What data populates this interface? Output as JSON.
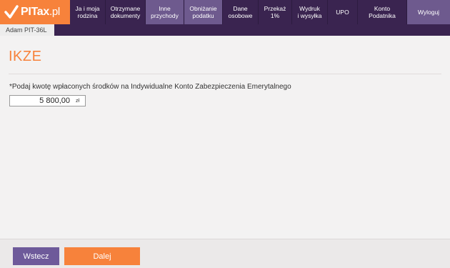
{
  "app": {
    "brand": "PITax",
    "brand_suffix": ".pl"
  },
  "nav": {
    "items": [
      {
        "key": "ja",
        "label": "Ja i moja\nrodzina"
      },
      {
        "key": "dokumenty",
        "label": "Otrzymane\ndokumenty"
      },
      {
        "key": "przychody",
        "label": "Inne\nprzychody"
      },
      {
        "key": "obnizanie",
        "label": "Obniżanie\npodatku"
      },
      {
        "key": "dane",
        "label": "Dane\nosobowe"
      },
      {
        "key": "przekaz",
        "label": "Przekaż\n1%"
      },
      {
        "key": "wydruk",
        "label": "Wydruk\ni wysyłka"
      },
      {
        "key": "upo",
        "label": "UPO"
      },
      {
        "key": "konto",
        "label": "Konto\nPodatnika"
      },
      {
        "key": "wyloguj",
        "label": "Wyloguj"
      }
    ]
  },
  "person_tab": "Adam PIT-36L",
  "page": {
    "title": "IKZE",
    "question": "*Podaj kwotę wpłaconych środków na Indywidualne Konto Zabezpieczenia Emerytalnego",
    "amount_value": "5 800,00",
    "currency": "zł"
  },
  "footer": {
    "back_label": "Wstecz",
    "next_label": "Dalej"
  },
  "colors": {
    "accent": "#f7823b",
    "nav_dark": "#3a2450",
    "nav_light": "#6e5a8e",
    "button_purple": "#6e5a9a"
  }
}
